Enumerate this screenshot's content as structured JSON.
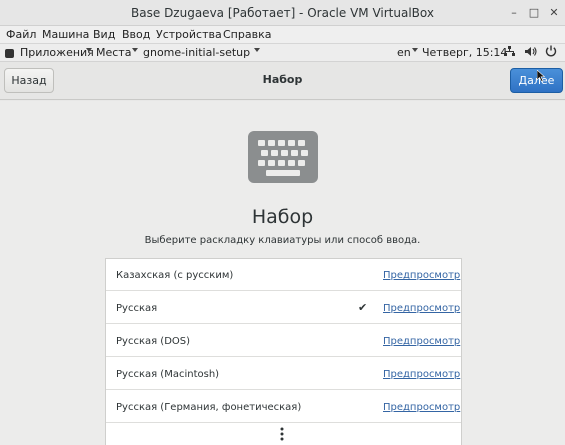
{
  "window": {
    "title": "Base Dzugaeva [Работает] - Oracle VM VirtualBox",
    "controls": {
      "minimize": "–",
      "maximize": "□",
      "close": "✕"
    }
  },
  "vb_menu": [
    "Файл",
    "Машина",
    "Вид",
    "Ввод",
    "Устройства",
    "Справка"
  ],
  "gnome_bar": {
    "apps": "Приложения",
    "places": "Места",
    "app_name": "gnome-initial-setup",
    "lang": "en",
    "clock": "Четверг, 15:14",
    "icons": [
      "network-icon",
      "volume-icon",
      "power-icon"
    ]
  },
  "header": {
    "back_label": "Назад",
    "title": "Набор",
    "next_label": "Далее"
  },
  "main": {
    "title": "Набор",
    "subtitle": "Выберите раскладку клавиатуры или способ ввода."
  },
  "layouts": [
    {
      "name": "Казахская (с русским)",
      "preview": "Предпросмотр",
      "selected": false
    },
    {
      "name": "Русская",
      "preview": "Предпросмотр",
      "selected": true
    },
    {
      "name": "Русская (DOS)",
      "preview": "Предпросмотр",
      "selected": false
    },
    {
      "name": "Русская (Macintosh)",
      "preview": "Предпросмотр",
      "selected": false
    },
    {
      "name": "Русская (Германия, фонетическая)",
      "preview": "Предпросмотр",
      "selected": false
    }
  ],
  "colors": {
    "accent": "#3584e4",
    "link": "#3465a4"
  }
}
